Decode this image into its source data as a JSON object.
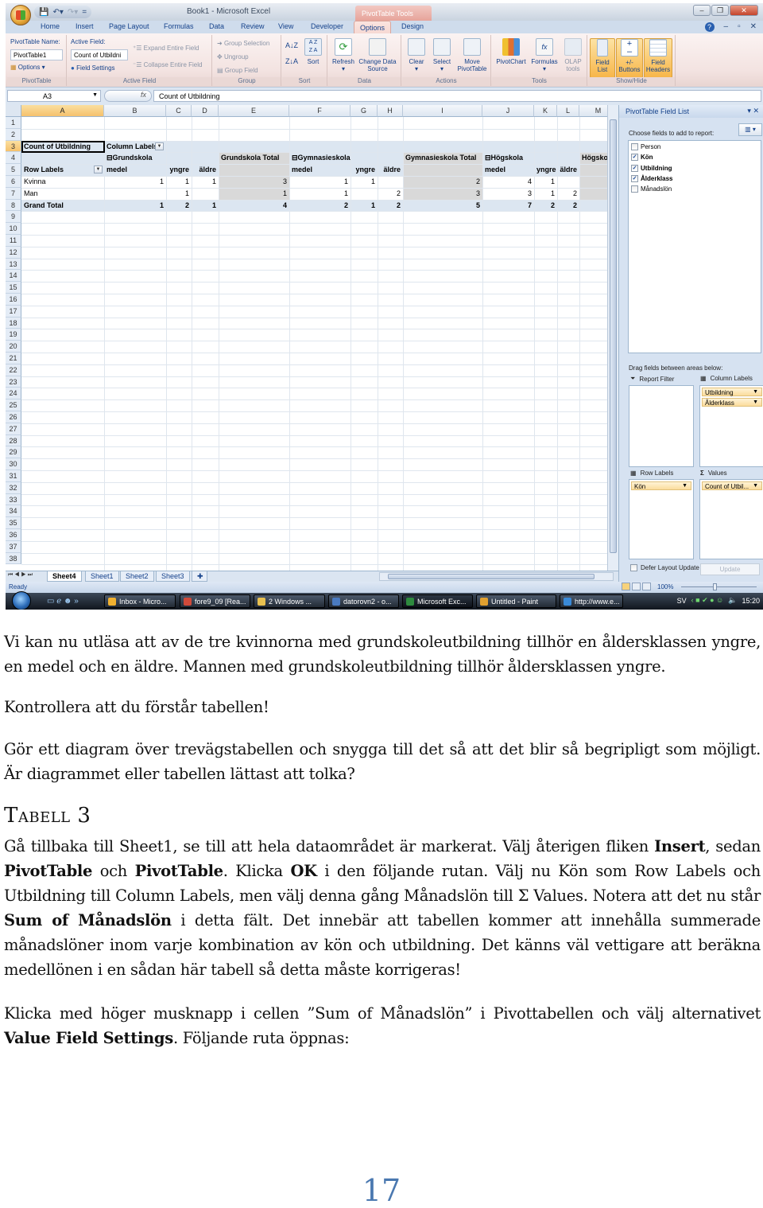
{
  "excel": {
    "quick_access": [
      "save-icon",
      "undo-icon",
      "redo-icon",
      "customize-icon"
    ],
    "app_title": "Book1 - Microsoft Excel",
    "context_tab_title": "PivotTable Tools",
    "window_controls": {
      "minimize": "–",
      "restore": "❐",
      "close": "✕"
    },
    "tabs": [
      "Home",
      "Insert",
      "Page Layout",
      "Formulas",
      "Data",
      "Review",
      "View",
      "Developer",
      "Options",
      "Design"
    ],
    "active_tab": "Options",
    "help_controls": {
      "help": "?",
      "minimize": "–",
      "restore": "▫",
      "close": "✕"
    },
    "ribbon": {
      "pivottable": {
        "name_label": "PivotTable Name:",
        "name_value": "PivotTable1",
        "options_label": "Options ▾",
        "group_label": "PivotTable"
      },
      "active_field": {
        "label": "Active Field:",
        "value": "Count of Utbildni",
        "field_settings": "Field Settings",
        "expand": "Expand Entire Field",
        "collapse": "Collapse Entire Field",
        "group_label": "Active Field"
      },
      "group": {
        "group_selection": "Group Selection",
        "ungroup": "Ungroup",
        "group_field": "Group Field",
        "group_label": "Group"
      },
      "sort": {
        "az": "A↓Z",
        "za": "Z↓A",
        "sort": "Sort",
        "group_label": "Sort"
      },
      "data": {
        "refresh": "Refresh",
        "change_source": "Change Data Source",
        "group_label": "Data"
      },
      "actions": {
        "clear": "Clear",
        "select": "Select",
        "move": "Move PivotTable",
        "group_label": "Actions"
      },
      "tools": {
        "pivotchart": "PivotChart",
        "formulas": "Formulas",
        "olap": "OLAP tools",
        "group_label": "Tools"
      },
      "show_hide": {
        "field_list": "Field List",
        "buttons": "+/- Buttons",
        "headers": "Field Headers",
        "group_label": "Show/Hide"
      }
    },
    "formula_bar": {
      "name_box": "A3",
      "fx": "fx",
      "content": "Count of Utbildning"
    },
    "columns": [
      "A",
      "B",
      "C",
      "D",
      "E",
      "F",
      "G",
      "H",
      "I",
      "J",
      "K",
      "L",
      "M"
    ],
    "rows": [
      "1",
      "2",
      "3",
      "4",
      "5",
      "6",
      "7",
      "8",
      "9",
      "10",
      "11",
      "12",
      "13",
      "14",
      "15",
      "16",
      "17",
      "18",
      "19",
      "20",
      "21",
      "22",
      "23",
      "24",
      "25",
      "26",
      "27",
      "28",
      "29",
      "30",
      "31",
      "32",
      "33",
      "34",
      "35",
      "36",
      "37",
      "38"
    ],
    "pivot": {
      "value_field": "Count of Utbildning",
      "column_labels": "Column Labels",
      "row_labels": "Row Labels",
      "groups": [
        {
          "name": "Grundskola",
          "total_label": "Grundskola Total"
        },
        {
          "name": "Gymnasieskola",
          "total_label": "Gymnasieskola Total"
        },
        {
          "name": "Högskola",
          "total_label": "Högskola T"
        }
      ],
      "subheaders": [
        "medel",
        "yngre",
        "äldre"
      ],
      "data_rows": [
        {
          "label": "Kvinna",
          "grund": [
            "1",
            "1",
            "1"
          ],
          "grund_total": "3",
          "gym": [
            "1",
            "1",
            ""
          ],
          "gym_total": "2",
          "hog": [
            "4",
            "1",
            ""
          ]
        },
        {
          "label": "Man",
          "grund": [
            "",
            "1",
            ""
          ],
          "grund_total": "1",
          "gym": [
            "1",
            "",
            "2"
          ],
          "gym_total": "3",
          "hog": [
            "3",
            "1",
            "2"
          ]
        }
      ],
      "grand_total": {
        "label": "Grand Total",
        "grund": [
          "1",
          "2",
          "1"
        ],
        "grund_total": "4",
        "gym": [
          "2",
          "1",
          "2"
        ],
        "gym_total": "5",
        "hog": [
          "7",
          "2",
          "2"
        ]
      }
    },
    "sheet_tabs": [
      "Sheet4",
      "Sheet1",
      "Sheet2",
      "Sheet3"
    ],
    "active_sheet": "Sheet4",
    "status": "Ready",
    "zoom_level": "100%",
    "field_list": {
      "title": "PivotTable Field List",
      "choose_label": "Choose fields to add to report:",
      "fields": [
        {
          "name": "Person",
          "checked": false
        },
        {
          "name": "Kön",
          "checked": true
        },
        {
          "name": "Utbildning",
          "checked": true
        },
        {
          "name": "Ålderklass",
          "checked": true
        },
        {
          "name": "Månadslön",
          "checked": false
        }
      ],
      "drag_label": "Drag fields between areas below:",
      "report_filter_label": "Report Filter",
      "column_labels_label": "Column Labels",
      "row_labels_label": "Row Labels",
      "values_label": "Values",
      "column_fields": [
        "Utbildning",
        "Ålderklass"
      ],
      "row_fields": [
        "Kön"
      ],
      "value_fields": [
        "Count of Utbil..."
      ],
      "defer_label": "Defer Layout Update",
      "update_label": "Update"
    },
    "taskbar": {
      "items": [
        {
          "label": "Inbox - Micro...",
          "color": "#f0b030"
        },
        {
          "label": "fore9_09 [Rea...",
          "color": "#d04a3a"
        },
        {
          "label": "2 Windows ...",
          "color": "#e8c050"
        },
        {
          "label": "datorovn2 - o...",
          "color": "#4a7ac0"
        },
        {
          "label": "Microsoft Exc...",
          "color": "#2e8a3e"
        },
        {
          "label": "Untitled - Paint",
          "color": "#e0a030"
        },
        {
          "label": "http://www.e...",
          "color": "#3a8ad8"
        }
      ],
      "active_item": "Microsoft Exc...",
      "lang": "SV",
      "clock": "15:20"
    }
  },
  "document": {
    "para1": "Vi kan nu utläsa att av de tre kvinnorna med grundskoleutbildning tillhör en åldersklassen yngre, en medel och en äldre. Mannen med grundskoleutbildning tillhör åldersklassen yngre.",
    "para2": "Kontrollera att du förstår tabellen!",
    "para3": "Gör ett diagram över trevägstabellen och snygga till det så att det blir så begripligt som möjligt. Är diagrammet eller tabellen lättast att tolka?",
    "heading": "Tabell 3",
    "para4": {
      "t1": "Gå tillbaka till Sheet1, se till att hela dataområdet är markerat. Välj återigen fliken ",
      "b1": "Insert",
      "t2": ", sedan ",
      "b2": "PivotTable",
      "t3": " och ",
      "b3": "PivotTable",
      "t4": ". Klicka ",
      "b4": "OK",
      "t5": " i den följande rutan. Välj nu Kön som Row Labels och Utbildning till Column Labels, men välj denna gång Månadslön till Σ Values. Notera att det nu står ",
      "b5": "Sum of Månadslön",
      "t6": " i detta fält. Det innebär att tabellen kommer att innehålla summerade månadslöner inom varje kombination av kön och utbildning. Det känns väl vettigare att beräkna medellönen i en sådan här tabell så detta måste korrigeras!"
    },
    "para5": {
      "t1": "Klicka med höger musknapp i cellen ”Sum of Månadslön” i Pivottabellen och välj alternativet ",
      "b1": "Value Field Settings",
      "t2": ". Följande ruta öppnas:"
    },
    "page_number": "17"
  }
}
